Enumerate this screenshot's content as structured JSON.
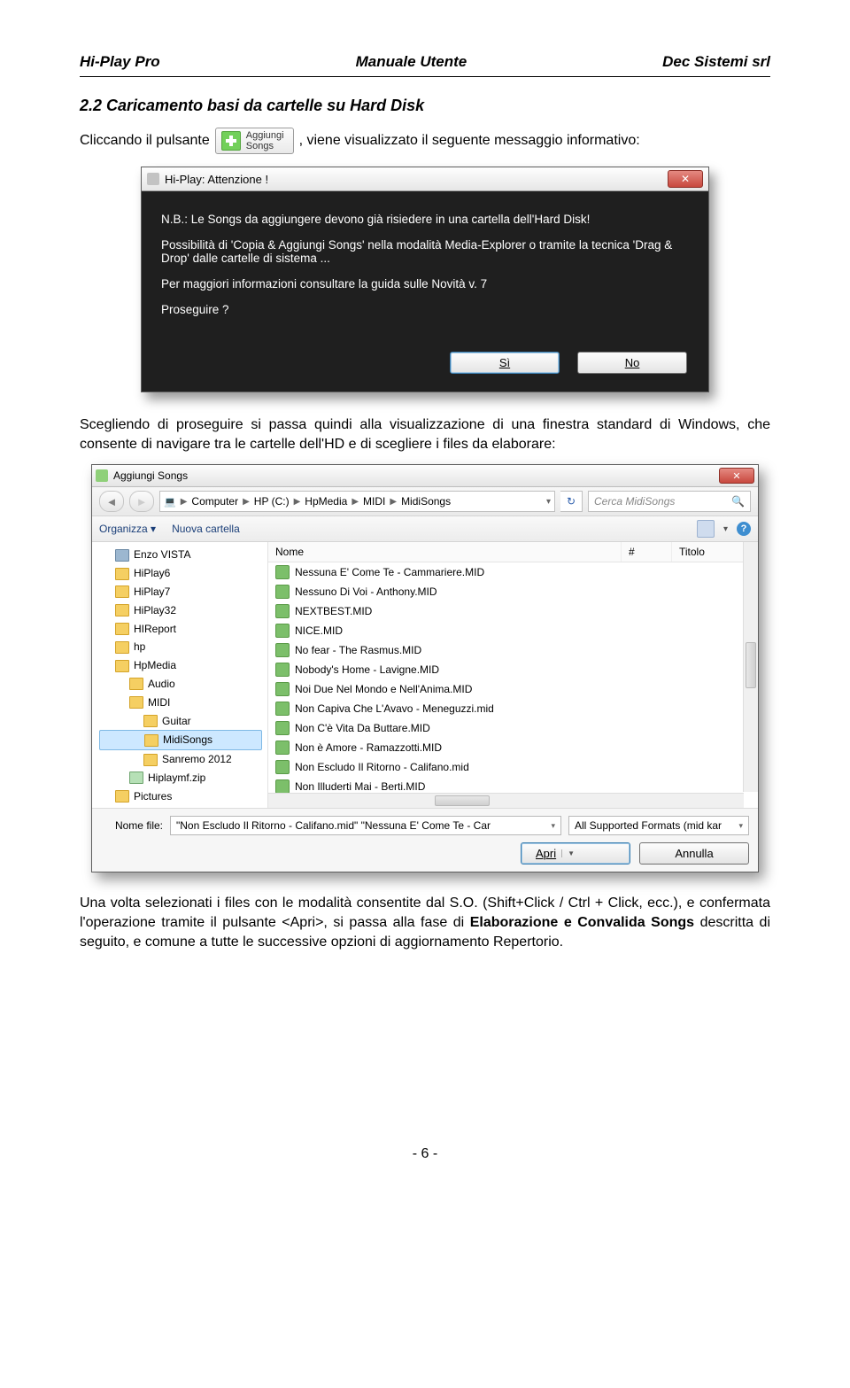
{
  "doc": {
    "header_left": "Hi-Play Pro",
    "header_center": "Manuale Utente",
    "header_right": "Dec Sistemi srl",
    "section_title": "2.2 Caricamento basi da cartelle su Hard Disk",
    "p1a": "Cliccando il pulsante",
    "p1b": ", viene visualizzato il seguente messaggio informativo:",
    "aggiungi_btn": "Aggiungi\nSongs",
    "p2": "Scegliendo di proseguire si passa quindi alla visualizzazione di una finestra standard di Windows, che consente di navigare tra le cartelle dell'HD e di scegliere i files da elaborare:",
    "p3a": "Una volta selezionati i files con le modalità consentite dal S.O. (Shift+Click / Ctrl + Click, ecc.), e confermata l'operazione tramite il pulsante <Apri>, si passa alla fase di ",
    "p3_bold": "Elaborazione e Convalida Songs",
    "p3b": " descritta di seguito, e comune a tutte le successive opzioni di aggiornamento Repertorio.",
    "footer": "- 6 -"
  },
  "dialog1": {
    "title": "Hi-Play: Attenzione !",
    "line1": "N.B.: Le Songs da aggiungere devono già risiedere in una cartella dell'Hard Disk!",
    "line2": "Possibilità di 'Copia & Aggiungi Songs' nella modalità Media-Explorer o tramite la tecnica 'Drag & Drop' dalle cartelle di sistema ...",
    "line3": "Per maggiori informazioni consultare la guida sulle Novità v. 7",
    "line4": "Proseguire ?",
    "yes": "Sì",
    "no": "No"
  },
  "filedlg": {
    "title": "Aggiungi Songs",
    "breadcrumb": [
      "Computer",
      "HP (C:)",
      "HpMedia",
      "MIDI",
      "MidiSongs"
    ],
    "search_placeholder": "Cerca MidiSongs",
    "toolbar": {
      "organize": "Organizza ▾",
      "newfolder": "Nuova cartella"
    },
    "tree": [
      {
        "ind": 1,
        "type": "drive",
        "label": "Enzo VISTA"
      },
      {
        "ind": 1,
        "type": "fold",
        "label": "HiPlay6"
      },
      {
        "ind": 1,
        "type": "fold",
        "label": "HiPlay7"
      },
      {
        "ind": 1,
        "type": "fold",
        "label": "HiPlay32"
      },
      {
        "ind": 1,
        "type": "fold",
        "label": "HIReport"
      },
      {
        "ind": 1,
        "type": "fold",
        "label": "hp"
      },
      {
        "ind": 1,
        "type": "fold",
        "label": "HpMedia"
      },
      {
        "ind": 2,
        "type": "fold",
        "label": "Audio"
      },
      {
        "ind": 2,
        "type": "fold",
        "label": "MIDI"
      },
      {
        "ind": 3,
        "type": "fold",
        "label": "Guitar"
      },
      {
        "ind": 3,
        "type": "fold",
        "label": "MidiSongs",
        "sel": true
      },
      {
        "ind": 3,
        "type": "fold",
        "label": "Sanremo 2012"
      },
      {
        "ind": 2,
        "type": "zip",
        "label": "Hiplaymf.zip"
      },
      {
        "ind": 1,
        "type": "fold",
        "label": "Pictures"
      }
    ],
    "columns": {
      "name": "Nome",
      "num": "#",
      "title": "Titolo"
    },
    "files": [
      "Nessuna E' Come Te - Cammariere.MID",
      "Nessuno Di Voi - Anthony.MID",
      "NEXTBEST.MID",
      "NICE.MID",
      "No fear - The Rasmus.MID",
      "Nobody's Home - Lavigne.MID",
      "Noi Due Nel Mondo e Nell'Anima.MID",
      "Non Capiva Che L'Avavo - Meneguzzi.mid",
      "Non C'è Vita Da Buttare.MID",
      "Non è Amore - Ramazzotti.MID",
      "Non Escludo Il Ritorno - Califano.mid",
      "Non Illuderti Mai - Berti.MID"
    ],
    "filename_label": "Nome file:",
    "filename_value": "\"Non Escludo Il Ritorno - Califano.mid\" \"Nessuna E' Come Te - Car",
    "format": "All Supported Formats (mid kar",
    "open": "Apri",
    "cancel": "Annulla"
  }
}
